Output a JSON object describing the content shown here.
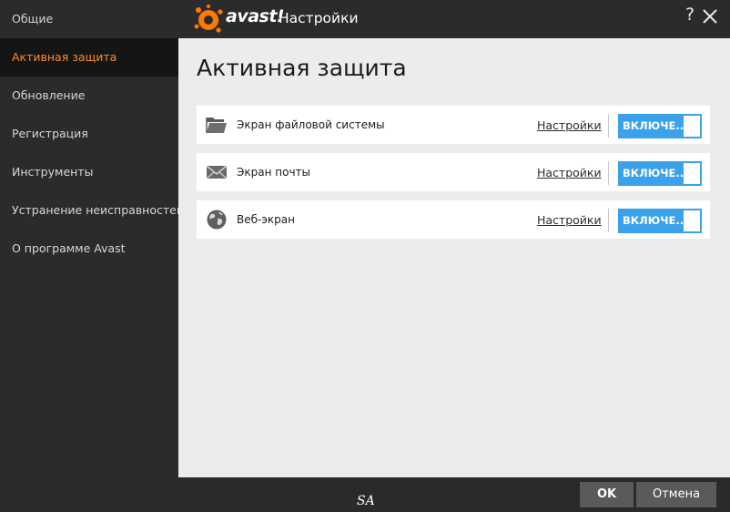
{
  "window": {
    "brand": "avast!",
    "title": "Настройки",
    "help": "?"
  },
  "sidebar": {
    "items": [
      {
        "label": "Общие",
        "active": false
      },
      {
        "label": "Активная защита",
        "active": true
      },
      {
        "label": "Обновление",
        "active": false
      },
      {
        "label": "Регистрация",
        "active": false
      },
      {
        "label": "Инструменты",
        "active": false
      },
      {
        "label": "Устранение неисправностей",
        "active": false
      },
      {
        "label": "О программе Avast",
        "active": false
      }
    ]
  },
  "main": {
    "title": "Активная защита",
    "shields": [
      {
        "icon": "folder-icon",
        "label": "Экран файловой системы",
        "settings": "Настройки",
        "toggle": "ВКЛЮЧЕ..."
      },
      {
        "icon": "envelope-icon",
        "label": "Экран почты",
        "settings": "Настройки",
        "toggle": "ВКЛЮЧЕ..."
      },
      {
        "icon": "globe-icon",
        "label": "Веб-экран",
        "settings": "Настройки",
        "toggle": "ВКЛЮЧЕ..."
      }
    ]
  },
  "footer": {
    "signature": "SA",
    "ok": "OK",
    "cancel": "Отмена"
  },
  "colors": {
    "accent": "#ff8c26",
    "toggle": "#3ba1ea",
    "sidebar": "#2b2b2b",
    "content": "#ececec"
  }
}
